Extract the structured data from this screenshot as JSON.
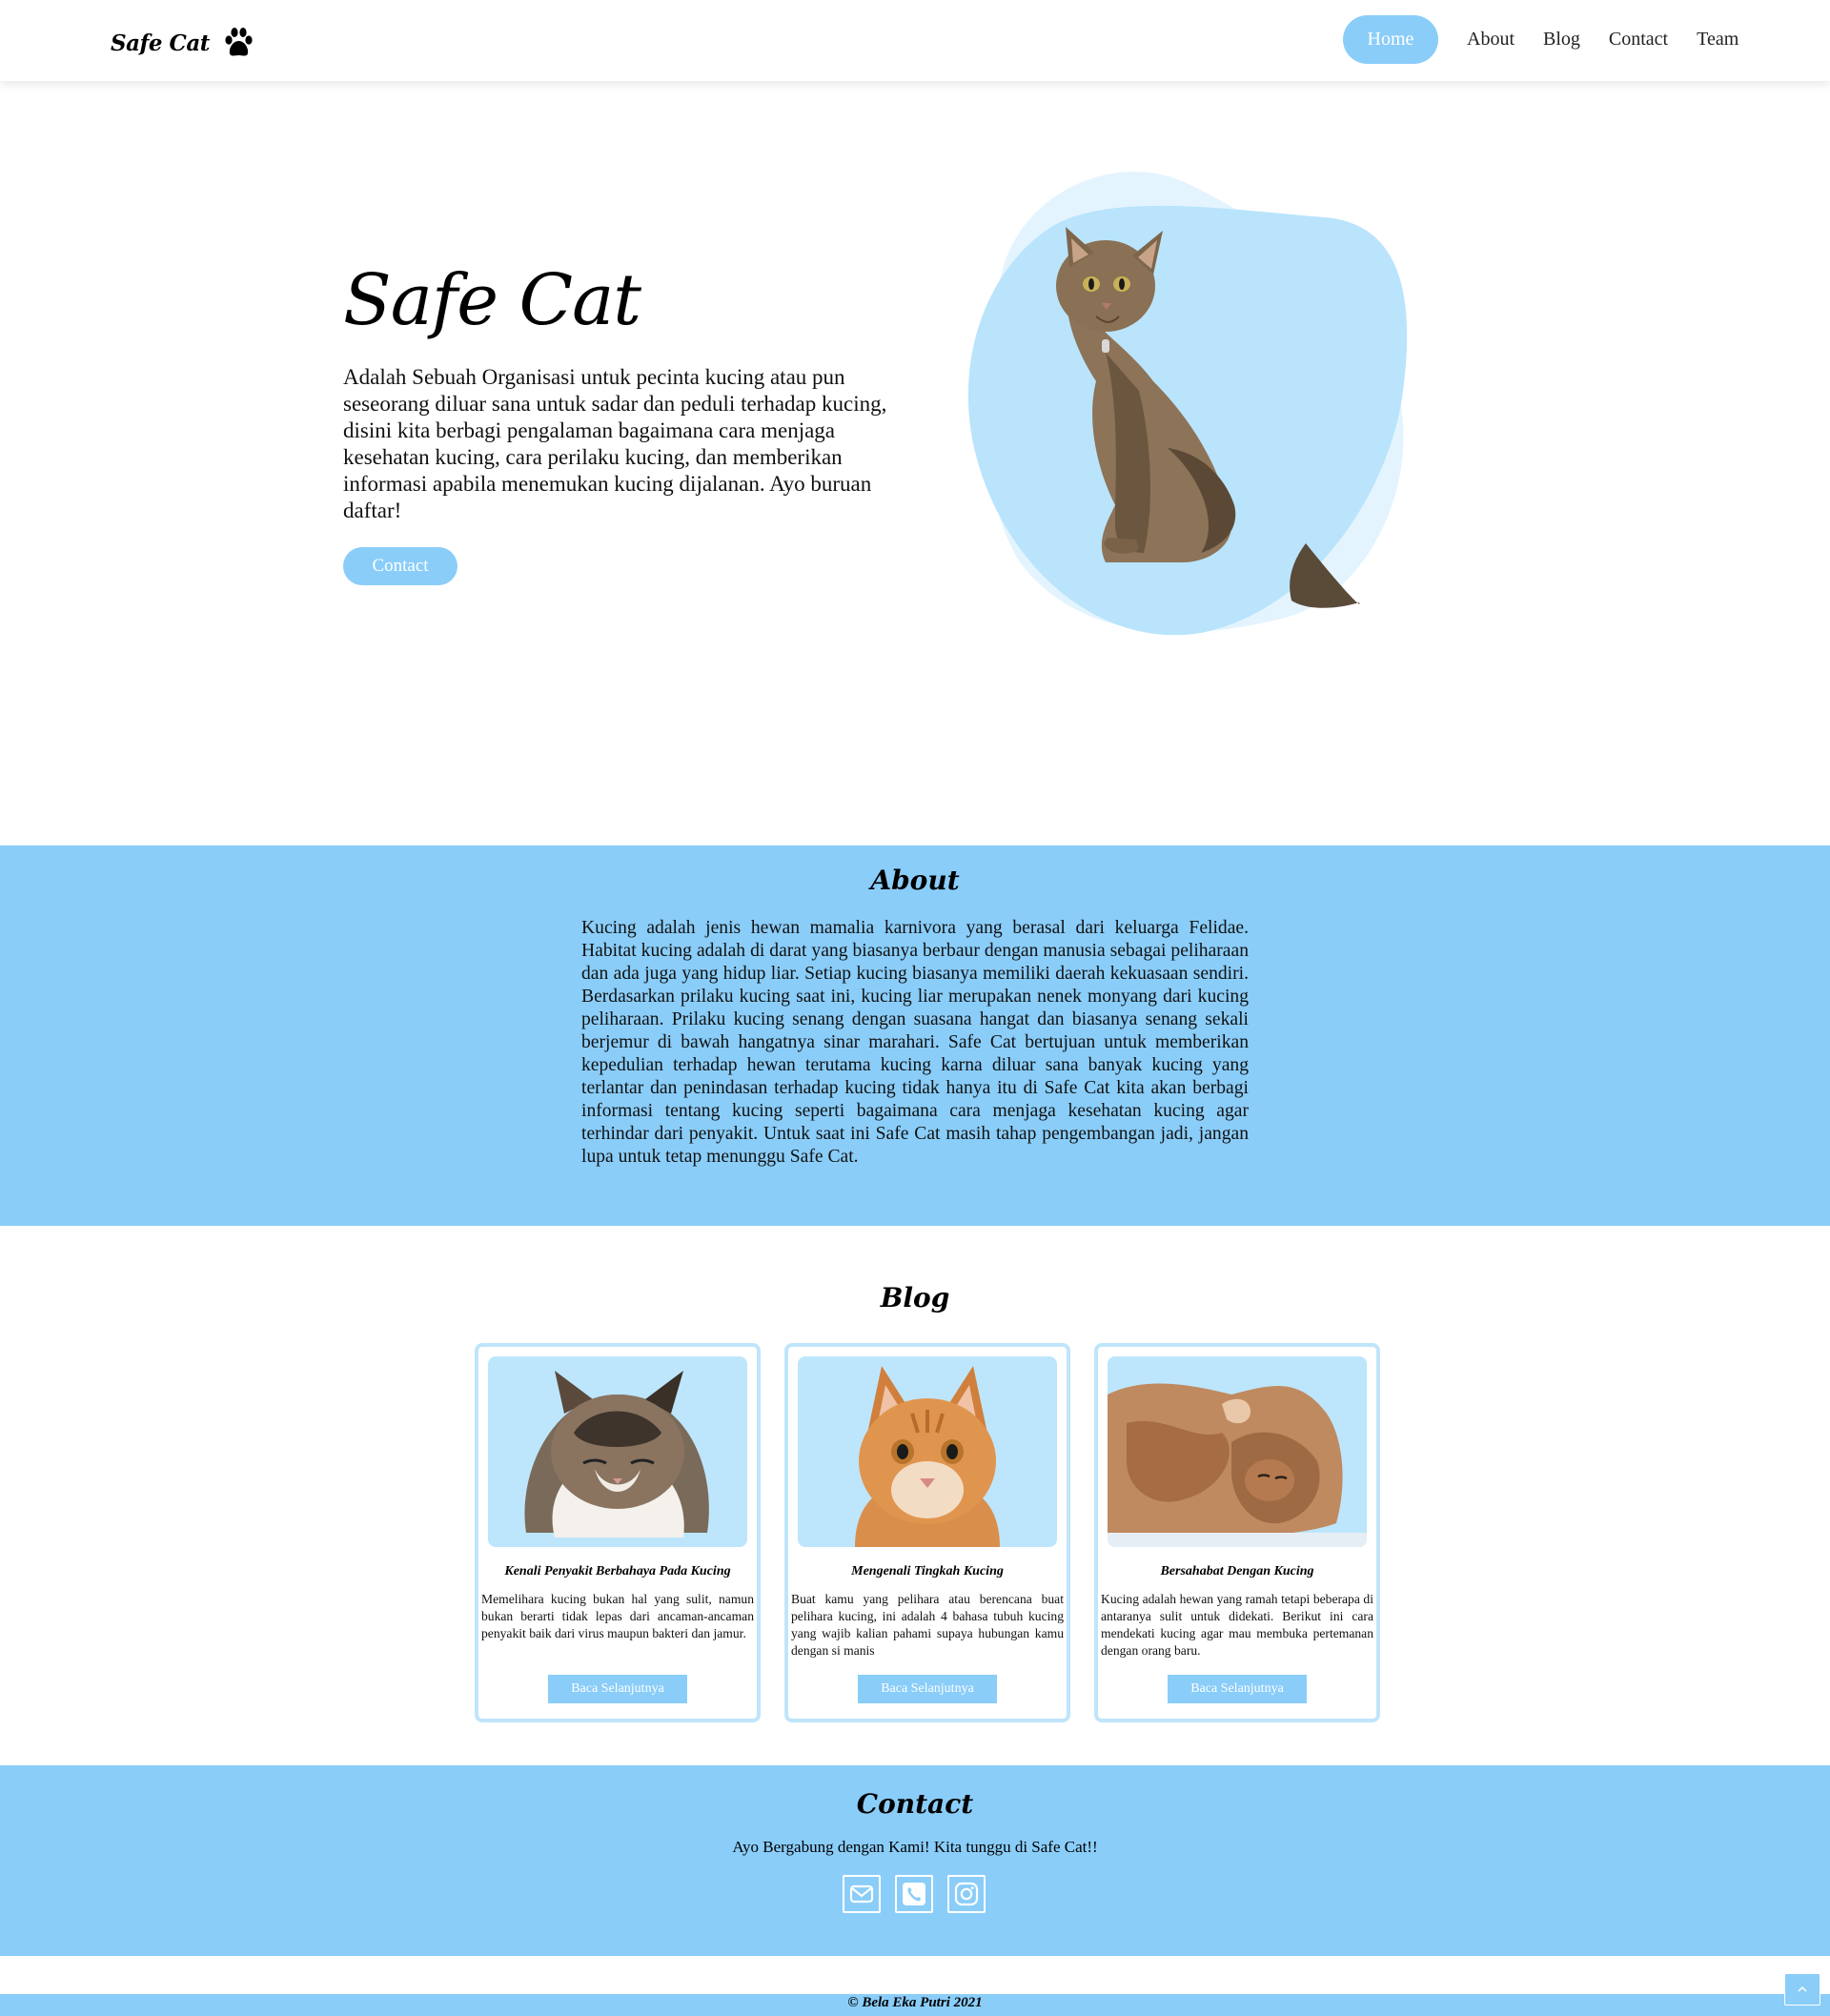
{
  "brand": {
    "name": "Safe Cat",
    "logo_icon": "paw-icon"
  },
  "nav": {
    "items": [
      {
        "label": "Home",
        "active": true
      },
      {
        "label": "About"
      },
      {
        "label": "Blog"
      },
      {
        "label": "Contact"
      },
      {
        "label": "Team"
      }
    ]
  },
  "hero": {
    "title": "Safe Cat",
    "description": "Adalah Sebuah Organisasi untuk pecinta kucing atau pun seseorang diluar sana untuk sadar dan peduli terhadap kucing, disini kita berbagi pengalaman bagaimana cara menjaga kesehatan kucing, cara perilaku kucing, dan memberikan informasi apabila menemukan kucing dijalanan. Ayo buruan daftar!",
    "button_label": "Contact"
  },
  "about": {
    "title": "About",
    "text": "Kucing adalah jenis hewan mamalia karnivora yang berasal dari keluarga Felidae. Habitat kucing adalah di darat yang biasanya berbaur dengan manusia sebagai peliharaan dan ada juga yang hidup liar. Setiap kucing biasanya memiliki daerah kekuasaan sendiri. Berdasarkan prilaku kucing saat ini, kucing liar merupakan nenek monyang dari kucing peliharaan. Prilaku kucing senang dengan suasana hangat dan biasanya senang sekali berjemur di bawah hangatnya sinar marahari. Safe Cat bertujuan untuk memberikan kepedulian terhadap hewan terutama kucing karna diluar sana banyak kucing yang terlantar dan penindasan terhadap kucing tidak hanya itu di Safe Cat kita akan berbagi informasi tentang kucing seperti bagaimana cara menjaga kesehatan kucing agar terhindar dari penyakit. Untuk saat ini Safe Cat masih tahap pengembangan jadi, jangan lupa untuk tetap menunggu Safe Cat."
  },
  "blog": {
    "title": "Blog",
    "cards": [
      {
        "title": "Kenali Penyakit Berbahaya Pada Kucing",
        "text": "Memelihara kucing bukan hal yang sulit, namun bukan berarti tidak lepas dari ancaman-ancaman penyakit baik dari virus maupun bakteri dan jamur.",
        "button_label": "Baca Selanjutnya"
      },
      {
        "title": "Mengenali Tingkah Kucing",
        "text": "Buat kamu yang pelihara atau berencana buat pelihara kucing, ini adalah 4 bahasa tubuh kucing yang wajib kalian pahami supaya hubungan kamu dengan si manis",
        "button_label": "Baca Selanjutnya"
      },
      {
        "title": "Bersahabat Dengan Kucing",
        "text": "Kucing adalah hewan yang ramah tetapi beberapa di antaranya sulit untuk didekati. Berikut ini cara mendekati kucing agar mau membuka pertemanan dengan orang baru.",
        "button_label": "Baca Selanjutnya"
      }
    ]
  },
  "contact": {
    "title": "Contact",
    "text": "Ayo Bergabung dengan Kami! Kita tunggu di Safe Cat!!",
    "icons": [
      "envelope-icon",
      "phone-icon",
      "instagram-icon"
    ]
  },
  "footer": {
    "copyright": "© Bela Eka Putri 2021",
    "back_to_top_icon": "chevron-up-icon"
  },
  "colors": {
    "accent": "#8acdf9",
    "card_border": "#bfe5fb",
    "image_bg": "#bde6fc"
  }
}
